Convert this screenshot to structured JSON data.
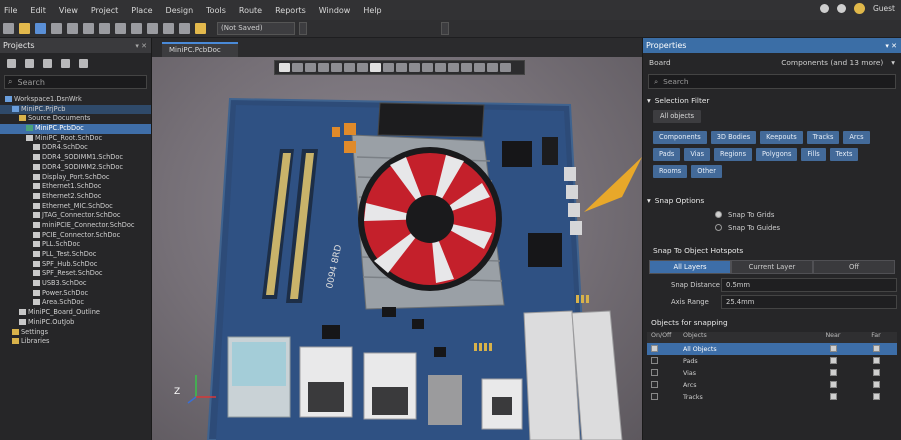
{
  "menu": [
    "File",
    "Edit",
    "View",
    "Project",
    "Place",
    "Design",
    "Tools",
    "Route",
    "Reports",
    "Window",
    "Help"
  ],
  "user": {
    "name": "Guest"
  },
  "toolbar": {
    "layer_combo": "(Not Saved)"
  },
  "projects_panel": {
    "title": "Projects",
    "search_placeholder": "Search",
    "tree": [
      {
        "label": "Workspace1.DsnWrk",
        "indent": 0,
        "icon": "proj",
        "state": ""
      },
      {
        "label": "MiniPC.PrjPcb",
        "indent": 1,
        "icon": "proj",
        "state": "hl"
      },
      {
        "label": "Source Documents",
        "indent": 2,
        "icon": "folder",
        "state": ""
      },
      {
        "label": "MiniPC.PcbDoc",
        "indent": 3,
        "icon": "pcb",
        "state": "sel"
      },
      {
        "label": "MiniPC_Root.SchDoc",
        "indent": 3,
        "icon": "file",
        "state": ""
      },
      {
        "label": "DDR4.SchDoc",
        "indent": 4,
        "icon": "file",
        "state": ""
      },
      {
        "label": "DDR4_SODIMM1.SchDoc",
        "indent": 4,
        "icon": "file",
        "state": ""
      },
      {
        "label": "DDR4_SODIMM2.SchDoc",
        "indent": 4,
        "icon": "file",
        "state": ""
      },
      {
        "label": "Display_Port.SchDoc",
        "indent": 4,
        "icon": "file",
        "state": ""
      },
      {
        "label": "Ethernet1.SchDoc",
        "indent": 4,
        "icon": "file",
        "state": ""
      },
      {
        "label": "Ethernet2.SchDoc",
        "indent": 4,
        "icon": "file",
        "state": ""
      },
      {
        "label": "Ethernet_MIC.SchDoc",
        "indent": 4,
        "icon": "file",
        "state": ""
      },
      {
        "label": "JTAG_Connector.SchDoc",
        "indent": 4,
        "icon": "file",
        "state": ""
      },
      {
        "label": "miniPCIE_Connector.SchDoc",
        "indent": 4,
        "icon": "file",
        "state": ""
      },
      {
        "label": "PCIE_Connector.SchDoc",
        "indent": 4,
        "icon": "file",
        "state": ""
      },
      {
        "label": "PLL.SchDoc",
        "indent": 4,
        "icon": "file",
        "state": ""
      },
      {
        "label": "PLL_Test.SchDoc",
        "indent": 4,
        "icon": "file",
        "state": ""
      },
      {
        "label": "SPF_Hub.SchDoc",
        "indent": 4,
        "icon": "file",
        "state": ""
      },
      {
        "label": "SPF_Reset.SchDoc",
        "indent": 4,
        "icon": "file",
        "state": ""
      },
      {
        "label": "USB3.SchDoc",
        "indent": 4,
        "icon": "file",
        "state": ""
      },
      {
        "label": "Power.SchDoc",
        "indent": 4,
        "icon": "file",
        "state": ""
      },
      {
        "label": "Area.SchDoc",
        "indent": 4,
        "icon": "file",
        "state": ""
      },
      {
        "label": "MiniPC_Board_Outline",
        "indent": 2,
        "icon": "file",
        "state": ""
      },
      {
        "label": "MiniPC.OutJob",
        "indent": 2,
        "icon": "file",
        "state": ""
      },
      {
        "label": "Settings",
        "indent": 1,
        "icon": "folder",
        "state": ""
      },
      {
        "label": "Libraries",
        "indent": 1,
        "icon": "folder",
        "state": ""
      }
    ]
  },
  "document_tab": {
    "label": "MiniPC.PcbDoc"
  },
  "viewport": {
    "axis_label": "Z",
    "board_marking": "0094 8RD"
  },
  "properties": {
    "title": "Properties",
    "board_label": "Board",
    "board_value": "Components (and 13 more)",
    "search_placeholder": "Search",
    "selection_filter_title": "Selection Filter",
    "all_objects": "All objects",
    "filter_chips": [
      "Components",
      "3D Bodies",
      "Keepouts",
      "Tracks",
      "Arcs",
      "Pads",
      "Vias",
      "Regions",
      "Polygons",
      "Fills",
      "Texts",
      "Rooms",
      "Other"
    ],
    "snap_options_title": "Snap Options",
    "snap_to_grids": "Snap To Grids",
    "snap_to_guides": "Snap To Guides",
    "hotspots_title": "Snap To Object Hotspots",
    "hotspot_options": [
      "All Layers",
      "Current Layer",
      "Off"
    ],
    "snap_distance_label": "Snap Distance",
    "snap_distance_value": "0.5mm",
    "axis_range_label": "Axis Range",
    "axis_range_value": "25.4mm",
    "objects_title": "Objects for snapping",
    "col_headers": [
      "On/Off",
      "Objects",
      "Near",
      "Far"
    ],
    "snap_rows": [
      {
        "on": true,
        "object": "All Objects",
        "near": true,
        "far": true
      },
      {
        "on": false,
        "object": "Pads",
        "near": true,
        "far": true
      },
      {
        "on": false,
        "object": "Vias",
        "near": true,
        "far": true
      },
      {
        "on": false,
        "object": "Arcs",
        "near": true,
        "far": true
      },
      {
        "on": false,
        "object": "Tracks",
        "near": true,
        "far": true
      }
    ]
  },
  "colors": {
    "accent": "#3d6ea8",
    "board": "#2d4b78",
    "fan_red": "#c4202b"
  }
}
